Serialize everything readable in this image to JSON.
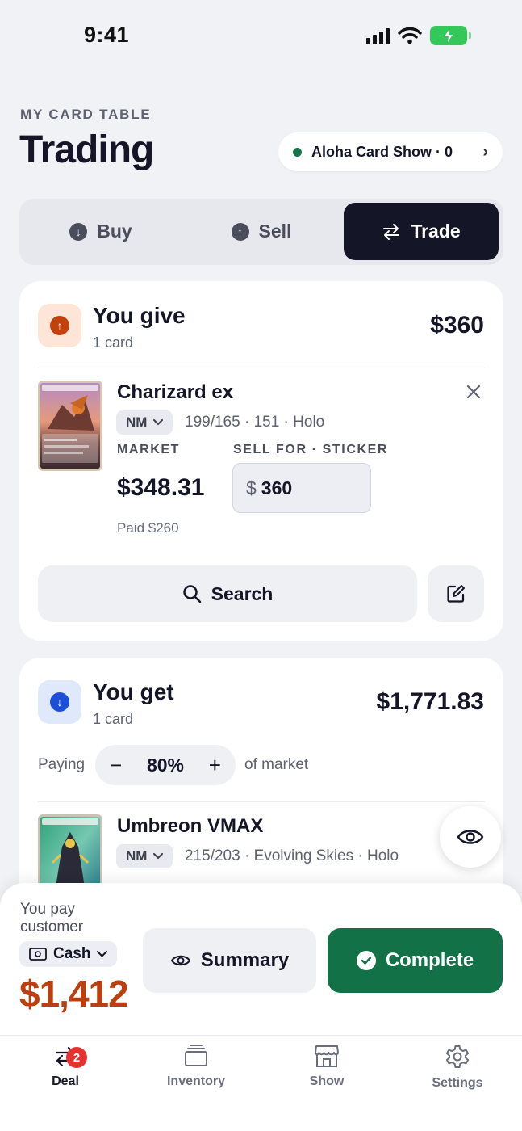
{
  "status_bar": {
    "time": "9:41"
  },
  "header": {
    "kicker": "MY CARD TABLE",
    "title": "Trading",
    "show_pill": "Aloha Card Show · 0"
  },
  "segments": [
    {
      "label": "Buy",
      "icon": "arrow-down-circle-icon"
    },
    {
      "label": "Sell",
      "icon": "arrow-up-circle-icon"
    },
    {
      "label": "Trade",
      "icon": "swap-arrows-icon",
      "active": true
    }
  ],
  "give": {
    "title": "You give",
    "count": "1 card",
    "total": "$360",
    "card": {
      "name": "Charizard ex",
      "condition": "NM",
      "meta": "199/165 · 151 · Holo",
      "market_label": "MARKET",
      "market_value": "$348.31",
      "sell_label": "SELL FOR · STICKER",
      "currency": "$",
      "sell_value": "360",
      "paid": "Paid $260"
    },
    "search_label": "Search"
  },
  "get": {
    "title": "You get",
    "count": "1 card",
    "total": "$1,771.83",
    "paying_label": "Paying",
    "paying_pct": "80%",
    "of_market": "of market",
    "card": {
      "name": "Umbreon VMAX",
      "condition": "NM",
      "meta": "215/203 · Evolving Skies · Holo"
    }
  },
  "footer": {
    "pay_label": "You pay customer",
    "method": "Cash",
    "amount": "$1,412",
    "summary_label": "Summary",
    "complete_label": "Complete"
  },
  "tabs": [
    {
      "label": "Deal",
      "icon": "swap-arrows-icon",
      "badge": "2",
      "active": true
    },
    {
      "label": "Inventory",
      "icon": "stack-icon"
    },
    {
      "label": "Show",
      "icon": "storefront-icon"
    },
    {
      "label": "Settings",
      "icon": "gear-icon"
    }
  ],
  "colors": {
    "dark": "#141628",
    "accent_green": "#137148",
    "pay_orange": "#bb3f0f",
    "give_bg": "#fde6d8",
    "give_icon": "#c2410c",
    "get_bg": "#dfe9fb",
    "get_icon": "#1d4ed8",
    "badge_red": "#e5312f"
  }
}
